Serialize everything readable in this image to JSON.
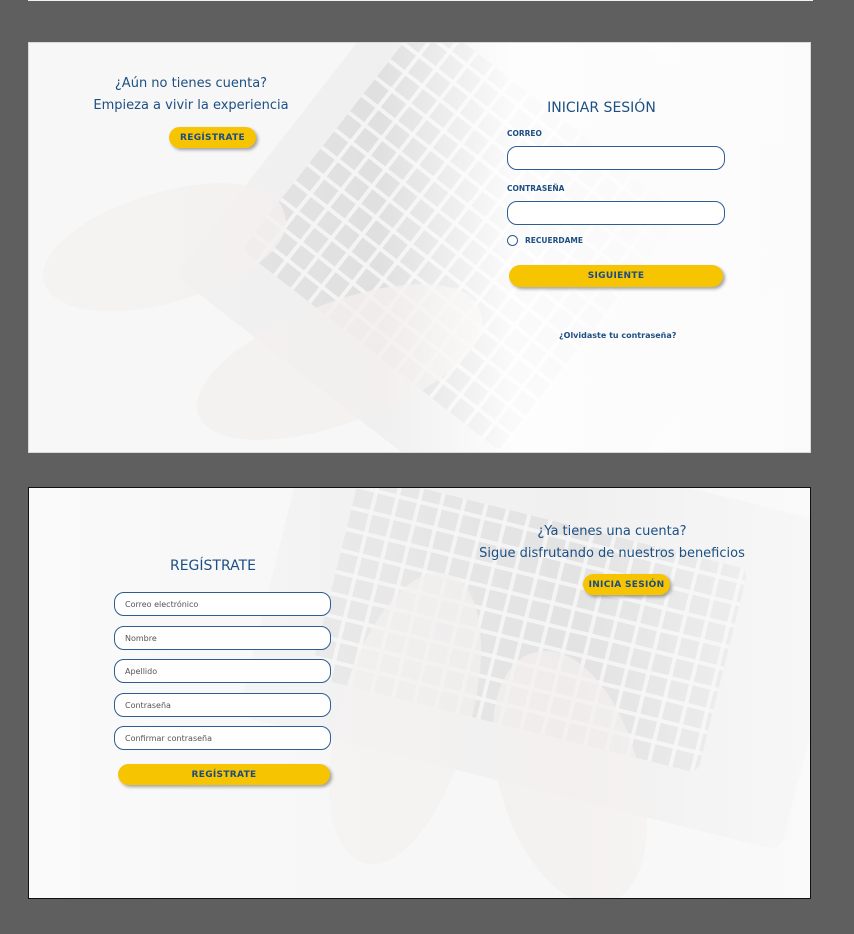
{
  "login_panel": {
    "promo_question": "¿Aún no tienes cuenta?",
    "promo_subtitle": "Empieza a vivir la experiencia",
    "promo_button": "REGÍSTRATE",
    "title": "INICIAR SESIÓN",
    "email_label": "CORREO",
    "email_value": "",
    "password_label": "CONTRASEÑA",
    "password_value": "",
    "remember_label": "RECUERDAME",
    "remember_checked": false,
    "submit_button": "SIGUIENTE",
    "forgot_link": "¿Olvidaste tu contraseña?"
  },
  "register_panel": {
    "title": "REGÍSTRATE",
    "fields": {
      "email_placeholder": "Correo electrónico",
      "first_name_placeholder": "Nombre",
      "last_name_placeholder": "Apellido",
      "password_placeholder": "Contraseña",
      "confirm_password_placeholder": "Confirmar contraseña"
    },
    "submit_button": "REGÍSTRATE",
    "promo_question": "¿Ya tienes una cuenta?",
    "promo_subtitle": "Sigue disfrutando de nuestros beneficios",
    "promo_button": "INICIA SESIÓN"
  },
  "colors": {
    "accent_yellow": "#f6c400",
    "brand_blue": "#1d4f84",
    "panel_background": "#f7f7f7",
    "page_background": "#5f5f5f"
  }
}
